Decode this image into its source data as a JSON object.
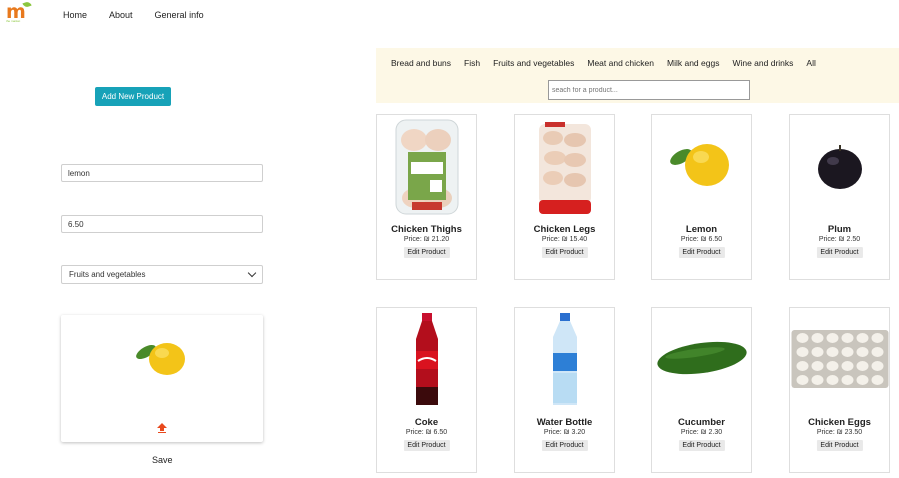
{
  "logo": {
    "text": "m",
    "subtext": "the market"
  },
  "nav": {
    "items": [
      "Home",
      "About",
      "General info"
    ]
  },
  "form": {
    "add_button": "Add New Product",
    "name_value": "lemon",
    "price_value": "6.50",
    "category_selected": "Fruits and vegetables",
    "save_label": "Save"
  },
  "categories": [
    "Bread and buns",
    "Fish",
    "Fruits and vegetables",
    "Meat and chicken",
    "Milk and eggs",
    "Wine and drinks",
    "All"
  ],
  "search": {
    "placeholder": "seach for a product..."
  },
  "edit_label": "Edit Product",
  "products": [
    {
      "name": "Chicken Thighs",
      "price": "Price: ₪ 21.20",
      "icon": "chicken-thighs-image"
    },
    {
      "name": "Chicken Legs",
      "price": "Price: ₪ 15.40",
      "icon": "chicken-legs-image"
    },
    {
      "name": "Lemon",
      "price": "Price: ₪ 6.50",
      "icon": "lemon-image"
    },
    {
      "name": "Plum",
      "price": "Price: ₪ 2.50",
      "icon": "plum-image"
    },
    {
      "name": "Coke",
      "price": "Price: ₪ 6.50",
      "icon": "coke-image"
    },
    {
      "name": "Water Bottle",
      "price": "Price: ₪ 3.20",
      "icon": "water-bottle-image"
    },
    {
      "name": "Cucumber",
      "price": "Price: ₪ 2.30",
      "icon": "cucumber-image"
    },
    {
      "name": "Chicken Eggs",
      "price": "Price: ₪ 23.50",
      "icon": "chicken-eggs-image"
    }
  ],
  "colors": {
    "accent": "#17a2b8",
    "category_bar": "#fdf8e6",
    "upload_icon": "#e8491d"
  }
}
